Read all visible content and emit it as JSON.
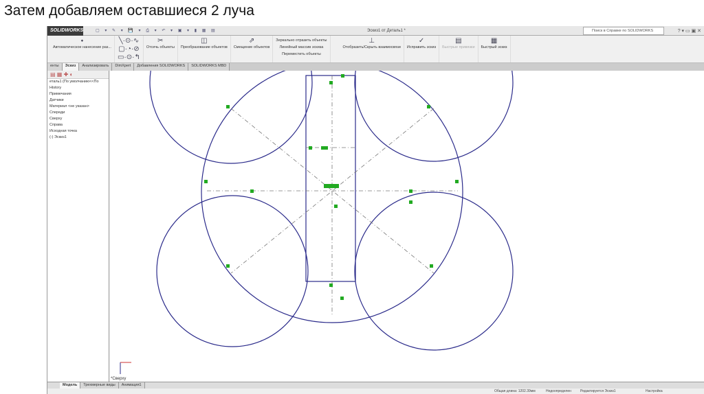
{
  "slide": {
    "title": "Затем добавляем оставшиеся 2 луча"
  },
  "app": {
    "logo": "SOLIDWORKS",
    "doc_title": "Эскиз1 от Деталь1 *",
    "search_placeholder": "Поиск в Справке по SOLIDWORKS"
  },
  "ribbon": {
    "groups": [
      {
        "label": "Автоматическое нанесение раз..."
      },
      {
        "label": "Отсечь объекты"
      },
      {
        "label": "Преобразование объектов"
      },
      {
        "label": "Смещение объектов"
      },
      {
        "label": "Отобразить/Скрыть взаимосвязи"
      },
      {
        "label": "Исправить эскиз"
      },
      {
        "label": "Быстрые привязки"
      },
      {
        "label": "Быстрый эскиз"
      }
    ],
    "list": [
      "Зеркально отразить объекты",
      "Линейный массив эскиза",
      "Переместить объекты"
    ]
  },
  "tabs": [
    "енты",
    "Эскиз",
    "Анализировать",
    "DimXpert",
    "Добавления SOLIDWORKS",
    "SOLIDWORKS MBD"
  ],
  "tree": {
    "root": "еталь1 (По умолчанию<<По",
    "items": [
      "History",
      "Примечания",
      "Датчики",
      "Материал <не указан>",
      "Спереди",
      "Сверху",
      "Справа",
      "Исходная точка",
      "(-) Эскиз1"
    ]
  },
  "view": {
    "label": "*Сверху"
  },
  "bottom_tabs": [
    "Модель",
    "Трехмерные виды",
    "Анимация1"
  ],
  "status": {
    "length": "Общая длина: 1202.39мм",
    "state": "Недоопределен",
    "editing": "Редактируется Эскиз1",
    "settings": "Настройка"
  },
  "colors": {
    "sketch": "#2a2a8a",
    "relation": "#22aa22"
  }
}
